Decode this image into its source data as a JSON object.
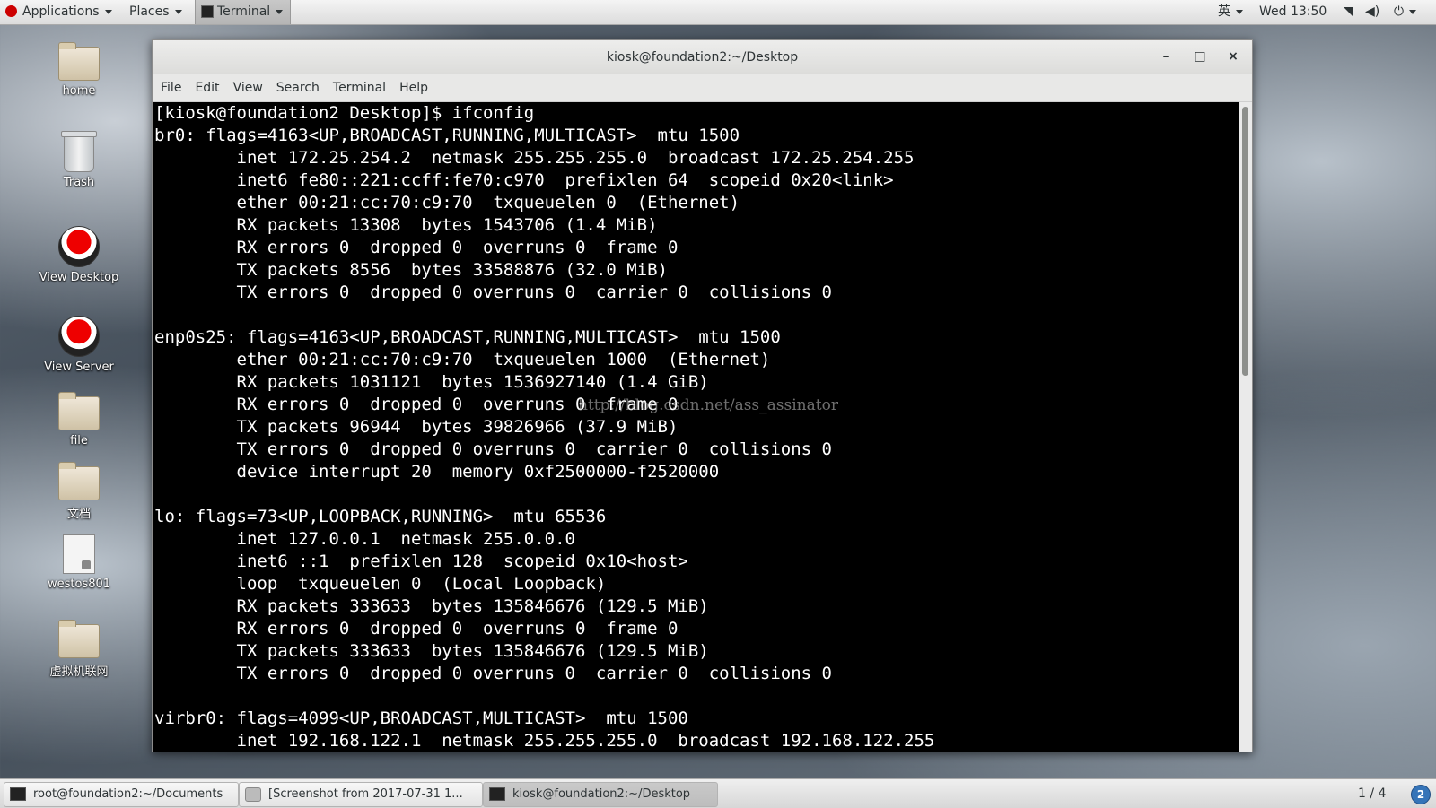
{
  "topbar": {
    "applications": "Applications",
    "places": "Places",
    "active_app": "Terminal",
    "input_method": "英",
    "clock": "Wed 13:50"
  },
  "desktop_icons": [
    {
      "label": "home"
    },
    {
      "label": "Trash"
    },
    {
      "label": "View Desktop"
    },
    {
      "label": "View Server"
    },
    {
      "label": "file"
    },
    {
      "label": "文档"
    },
    {
      "label": "westos801"
    },
    {
      "label": "虚拟机联网"
    }
  ],
  "window": {
    "title": "kiosk@foundation2:~/Desktop",
    "minimize": "–",
    "maximize": "□",
    "close": "×",
    "menu": [
      "File",
      "Edit",
      "View",
      "Search",
      "Terminal",
      "Help"
    ]
  },
  "terminal": {
    "lines": [
      "[kiosk@foundation2 Desktop]$ ifconfig",
      "br0: flags=4163<UP,BROADCAST,RUNNING,MULTICAST>  mtu 1500",
      "        inet 172.25.254.2  netmask 255.255.255.0  broadcast 172.25.254.255",
      "        inet6 fe80::221:ccff:fe70:c970  prefixlen 64  scopeid 0x20<link>",
      "        ether 00:21:cc:70:c9:70  txqueuelen 0  (Ethernet)",
      "        RX packets 13308  bytes 1543706 (1.4 MiB)",
      "        RX errors 0  dropped 0  overruns 0  frame 0",
      "        TX packets 8556  bytes 33588876 (32.0 MiB)",
      "        TX errors 0  dropped 0 overruns 0  carrier 0  collisions 0",
      "",
      "enp0s25: flags=4163<UP,BROADCAST,RUNNING,MULTICAST>  mtu 1500",
      "        ether 00:21:cc:70:c9:70  txqueuelen 1000  (Ethernet)",
      "        RX packets 1031121  bytes 1536927140 (1.4 GiB)",
      "        RX errors 0  dropped 0  overruns 0  frame 0",
      "        TX packets 96944  bytes 39826966 (37.9 MiB)",
      "        TX errors 0  dropped 0 overruns 0  carrier 0  collisions 0",
      "        device interrupt 20  memory 0xf2500000-f2520000",
      "",
      "lo: flags=73<UP,LOOPBACK,RUNNING>  mtu 65536",
      "        inet 127.0.0.1  netmask 255.0.0.0",
      "        inet6 ::1  prefixlen 128  scopeid 0x10<host>",
      "        loop  txqueuelen 0  (Local Loopback)",
      "        RX packets 333633  bytes 135846676 (129.5 MiB)",
      "        RX errors 0  dropped 0  overruns 0  frame 0",
      "        TX packets 333633  bytes 135846676 (129.5 MiB)",
      "        TX errors 0  dropped 0 overruns 0  carrier 0  collisions 0",
      "",
      "virbr0: flags=4099<UP,BROADCAST,MULTICAST>  mtu 1500",
      "        inet 192.168.122.1  netmask 255.255.255.0  broadcast 192.168.122.255"
    ],
    "watermark": "http://blog.csdn.net/ass_assinator"
  },
  "taskbar": {
    "tasks": [
      {
        "label": "root@foundation2:~/Documents"
      },
      {
        "label": "[Screenshot from 2017-07-31 1..."
      },
      {
        "label": "kiosk@foundation2:~/Desktop"
      }
    ],
    "workspace": "1 / 4",
    "notification_count": "2"
  }
}
